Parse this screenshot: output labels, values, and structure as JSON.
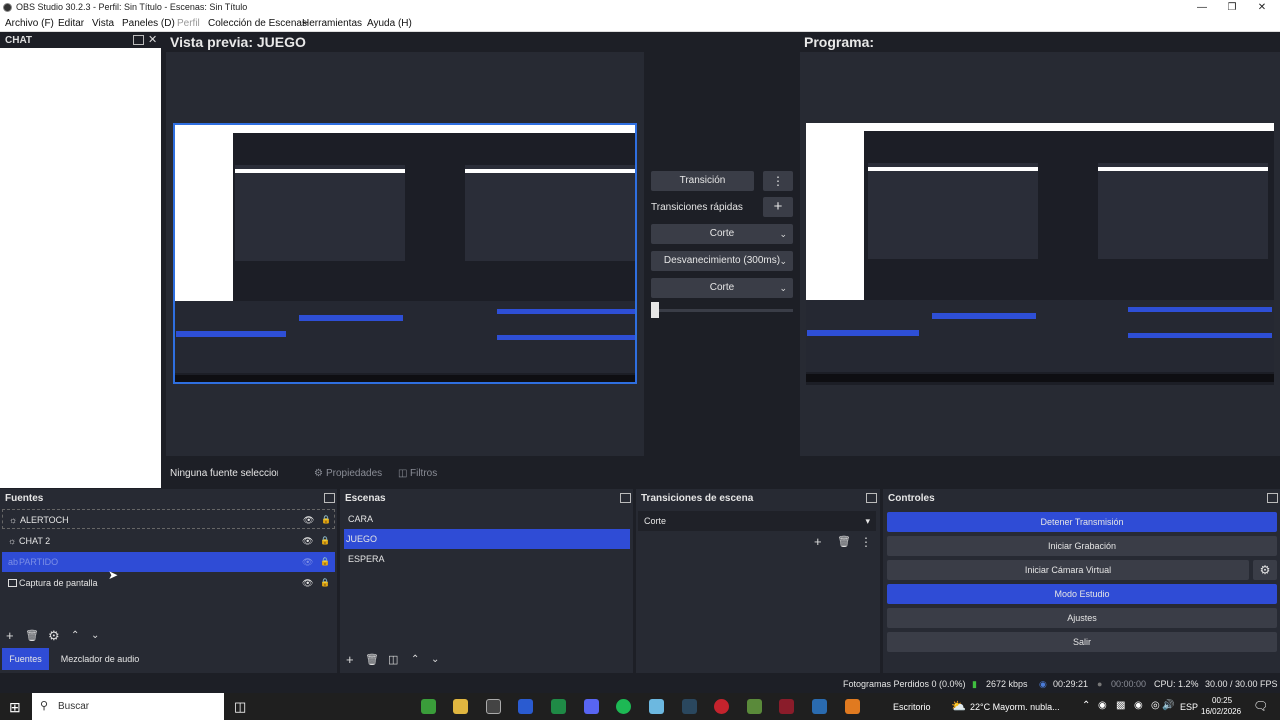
{
  "window": {
    "title": "OBS Studio 30.2.3 - Perfil: Sin Título - Escenas: Sin Título"
  },
  "menu": [
    "Archivo (F)",
    "Editar",
    "Vista",
    "Paneles (D)",
    "Perfil",
    "Colección de Escenas",
    "Herramientas",
    "Ayuda (H)"
  ],
  "chat": {
    "title": "CHAT"
  },
  "preview": {
    "left_label": "Vista previa: JUEGO",
    "right_label": "Programa:"
  },
  "transition_panel": {
    "transition_button": "Transición",
    "quick_label": "Transiciones rápidas",
    "quick_items": [
      "Corte",
      "Desvanecimiento (300ms)",
      "Corte"
    ]
  },
  "context_bar": {
    "no_source": "Ninguna fuente seleccionada",
    "properties": "Propiedades",
    "filters": "Filtros"
  },
  "sources": {
    "title": "Fuentes",
    "items": [
      {
        "name": "ALERTOCH",
        "selected": false
      },
      {
        "name": "CHAT 2",
        "selected": false
      },
      {
        "name": "PARTIDO",
        "selected": true
      },
      {
        "name": "Captura de pantalla",
        "selected": false
      }
    ],
    "tabs": [
      "Fuentes",
      "Mezclador de audio"
    ]
  },
  "scenes": {
    "title": "Escenas",
    "items": [
      {
        "name": "CARA",
        "selected": false
      },
      {
        "name": "JUEGO",
        "selected": true
      },
      {
        "name": "ESPERA",
        "selected": false
      }
    ]
  },
  "scene_transitions": {
    "title": "Transiciones de escena",
    "current": "Corte"
  },
  "controls": {
    "title": "Controles",
    "buttons": [
      {
        "label": "Detener Transmisión",
        "active": true
      },
      {
        "label": "Iniciar Grabación",
        "active": false
      },
      {
        "label": "Iniciar Cámara Virtual",
        "active": false
      },
      {
        "label": "Modo Estudio",
        "active": true
      },
      {
        "label": "Ajustes",
        "active": false
      },
      {
        "label": "Salir",
        "active": false
      }
    ]
  },
  "status": {
    "dropped": "Fotogramas Perdidos 0 (0.0%)",
    "bitrate": "2672 kbps",
    "stream_time": "00:29:21",
    "rec_time": "00:00:00",
    "cpu": "CPU: 1.2%",
    "fps": "30.00 / 30.00 FPS"
  },
  "taskbar": {
    "search": "Buscar",
    "desktop": "Escritorio",
    "weather": "22°C  Mayorm. nubla...",
    "lang": "ESP",
    "time": "00:25",
    "date": "16/02/2026"
  },
  "colors": {
    "accent": "#2f4cd6",
    "panel": "#272a33",
    "background": "#1d1f26",
    "button": "#3a3d47"
  }
}
